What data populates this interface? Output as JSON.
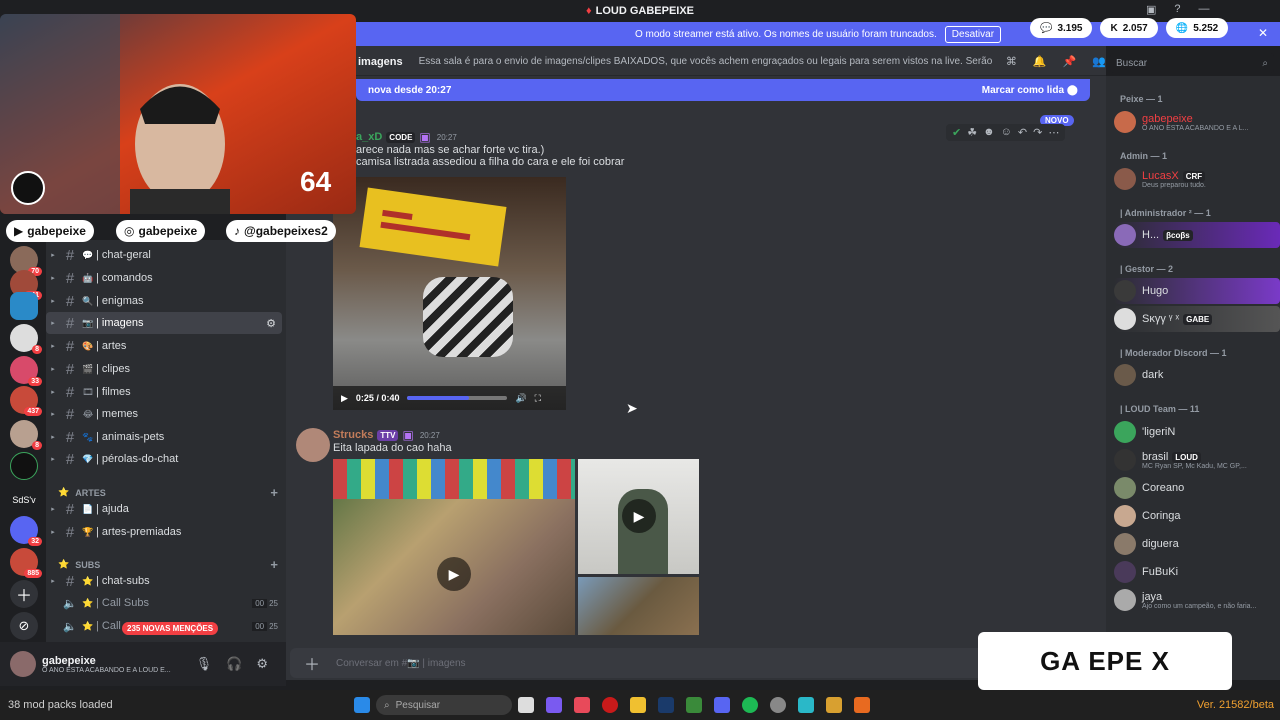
{
  "window": {
    "title": "LOUD GABEPEIXE"
  },
  "streamer_banner": {
    "text": "O modo streamer está ativo. Os nomes de usuário foram truncados.",
    "button": "Desativar"
  },
  "stat_pills": [
    {
      "icon": "chat",
      "value": "3.195"
    },
    {
      "icon": "kick",
      "value": "2.057"
    },
    {
      "icon": "globe",
      "value": "5.252"
    }
  ],
  "webcam": {
    "counter": "64"
  },
  "socials": [
    {
      "icon": "youtube",
      "handle": "gabepeixe"
    },
    {
      "icon": "instagram",
      "handle": "gabepeixe"
    },
    {
      "icon": "tiktok",
      "handle": "@gabepeixes2"
    }
  ],
  "servers": [
    {
      "badge": "70"
    },
    {
      "badge": "141"
    },
    {
      "badge": ""
    },
    {
      "badge": "8"
    },
    {
      "badge": "33"
    },
    {
      "badge": "437"
    },
    {
      "badge": "8"
    },
    {
      "badge": ""
    },
    {
      "label": "SdS'v"
    },
    {
      "badge": "32"
    },
    {
      "badge": "885"
    }
  ],
  "channels": {
    "text": [
      {
        "name": "| chat-geral",
        "emoji": "💬"
      },
      {
        "name": "| comandos",
        "emoji": "🤖"
      },
      {
        "name": "| enigmas",
        "emoji": "🔍"
      },
      {
        "name": "| imagens",
        "emoji": "📷",
        "active": true
      },
      {
        "name": "| artes",
        "emoji": "🎨"
      },
      {
        "name": "| clipes",
        "emoji": "🎬"
      },
      {
        "name": "| filmes",
        "emoji": "🎞"
      },
      {
        "name": "| memes",
        "emoji": "😂"
      },
      {
        "name": "| animais-pets",
        "emoji": "🐾"
      },
      {
        "name": "| pérolas-do-chat",
        "emoji": "💎"
      }
    ],
    "cat_artes": "ARTES",
    "artes": [
      {
        "name": "| ajuda",
        "emoji": "📄"
      },
      {
        "name": "| artes-premiadas",
        "emoji": "🏆"
      }
    ],
    "cat_subs": "SUBS",
    "subs": [
      {
        "name": "| chat-subs",
        "emoji": "⭐"
      }
    ],
    "voice": [
      {
        "name": "| Call Subs",
        "c1": "00",
        "c2": "25"
      },
      {
        "name": "| Call",
        "c1": "00",
        "c2": "25"
      }
    ],
    "mentions": "235 NOVAS MENÇÕES"
  },
  "user_panel": {
    "name": "gabepeixe",
    "status": "O ANO ESTA ACABANDO E A LOUD E..."
  },
  "topic": {
    "channel": "imagens",
    "text": "Essa sala é para o envio de imagens/clipes BAIXADOS, que vocês achem engraçados ou legais para serem vistos na live. Serão apagados prints de ou..."
  },
  "new_bar": {
    "text": "nova desde 20:27",
    "mark": "Marcar como lida"
  },
  "search": {
    "placeholder": "Buscar"
  },
  "messages": [
    {
      "user": "a_xD",
      "tag": "CODE",
      "time": "20:27",
      "badge": "NOVO",
      "lines": [
        "arece nada mas se achar forte vc tira.)",
        "camisa listrada assediou a filha do cara e ele foi cobrar"
      ],
      "video_time": "0:25 / 0:40",
      "progress": 0.62
    },
    {
      "user": "Strucks",
      "tag": "TTV",
      "time": "20:27",
      "lines": [
        "Eita lapada do cao haha"
      ]
    }
  ],
  "composer": {
    "placeholder": "Conversar em #📷 | imagens"
  },
  "members": {
    "groups": [
      {
        "header": "Peixe — 1",
        "members": [
          {
            "name": "gabepeixe",
            "sub": "O ANO ESTA ACABANDO E A L...",
            "color": "#f23f43"
          }
        ]
      },
      {
        "header": "Admin — 1",
        "members": [
          {
            "name": "LucasX",
            "tag": "CRF",
            "sub": "Deus preparou tudo.",
            "color": "#f23f43"
          }
        ]
      },
      {
        "header": "| Administrador ² — 1",
        "members": [
          {
            "name": "H...",
            "tag": "βcoβs",
            "color": "#ffffff"
          }
        ]
      },
      {
        "header": "| Gestor — 2",
        "members": [
          {
            "name": "Hugo",
            "color": "#ffffff"
          },
          {
            "name": "Sκγγ ᵞ ˣ",
            "tag": "GABE",
            "color": "#ffffff"
          }
        ]
      },
      {
        "header": "| Moderador Discord — 1",
        "members": [
          {
            "name": "dark",
            "color": "#ffffff"
          }
        ]
      },
      {
        "header": "| LOUD Team — 11",
        "members": [
          {
            "name": "'ligeriN",
            "color": "#ffffff"
          },
          {
            "name": "brasil",
            "tag": "LOUD",
            "sub": "MC Ryan SP, Mc Kadu, MC GP,...",
            "color": "#ffffff"
          },
          {
            "name": "Coreano",
            "color": "#ffffff"
          },
          {
            "name": "Coringa",
            "color": "#ffffff"
          },
          {
            "name": "diguera",
            "color": "#ffffff"
          },
          {
            "name": "FuBuKi",
            "color": "#ffffff"
          },
          {
            "name": "jaya",
            "sub": "Ajo como um campeão, e não faria...",
            "color": "#ffffff"
          }
        ]
      }
    ]
  },
  "overlay_logo": "GA EPE X",
  "taskbar": {
    "left": "38 mod packs loaded",
    "search": "Pesquisar",
    "version": "Ver. 21582/beta"
  }
}
